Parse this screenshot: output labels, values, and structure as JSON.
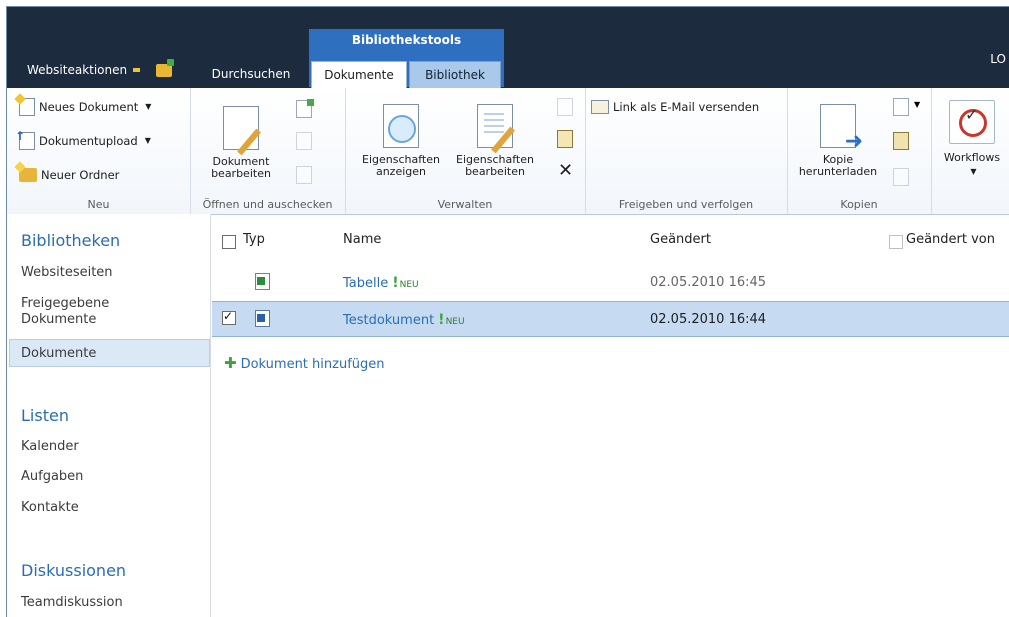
{
  "topbar": {
    "site_actions": "Websiteaktionen",
    "contextual_group": "Bibliothekstools",
    "tabs": [
      "Durchsuchen",
      "Dokumente",
      "Bibliothek"
    ],
    "user": "LO"
  },
  "ribbon": {
    "groups": {
      "new": {
        "label": "Neu",
        "new_document": "Neues Dokument",
        "upload_document": "Dokumentupload",
        "new_folder": "Neuer Ordner"
      },
      "open_checkout": {
        "label": "Öffnen und auschecken",
        "edit_document_1": "Dokument",
        "edit_document_2": "bearbeiten"
      },
      "manage": {
        "label": "Verwalten",
        "view_props_1": "Eigenschaften",
        "view_props_2": "anzeigen",
        "edit_props_1": "Eigenschaften",
        "edit_props_2": "bearbeiten"
      },
      "share": {
        "label": "Freigeben und verfolgen",
        "email_link": "Link als E-Mail versenden"
      },
      "copies": {
        "label": "Kopien",
        "download_1": "Kopie",
        "download_2": "herunterladen"
      },
      "workflows": {
        "label": "Workflows"
      }
    }
  },
  "leftnav": {
    "libraries_head": "Bibliotheken",
    "libraries": [
      "Websiteseiten",
      "Freigegebene Dokumente",
      "Dokumente"
    ],
    "lists_head": "Listen",
    "lists": [
      "Kalender",
      "Aufgaben",
      "Kontakte"
    ],
    "discussions_head": "Diskussionen",
    "discussions": [
      "Teamdiskussion"
    ]
  },
  "list": {
    "columns": [
      "Typ",
      "Name",
      "Geändert",
      "Geändert von"
    ],
    "rows": [
      {
        "name": "Tabelle",
        "badge": "NEU",
        "modified": "02.05.2010 16:45",
        "selected": false
      },
      {
        "name": "Testdokument",
        "badge": "NEU",
        "modified": "02.05.2010 16:44",
        "selected": true
      }
    ],
    "add_document": "Dokument hinzufügen"
  }
}
